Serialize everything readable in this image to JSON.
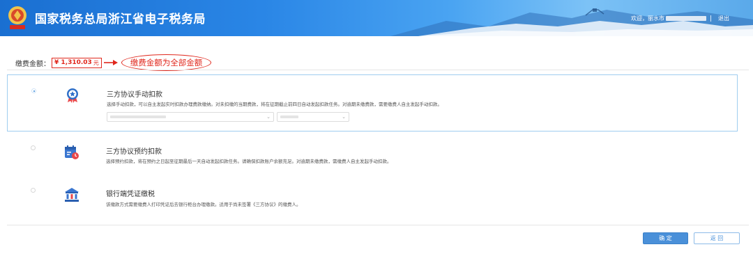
{
  "header": {
    "title": "国家税务总局浙江省电子税务局",
    "welcome": "欢迎，丽水市",
    "logout": "退出"
  },
  "payment": {
    "label": "缴费金额：",
    "amount": "¥ 1,310.03",
    "unit": "元",
    "annotation": "缴费金额为全部金额"
  },
  "options": [
    {
      "title": "三方协议手动扣款",
      "description": "选择手动扣款，可以自主发起实时扣款办理费款缴纳。对未扣缴的当期费款，将在征期截止前四日自动发起扣款任务。对逾期未缴费款，需要缴费人自主发起手动扣款。",
      "selected": true,
      "icon": "award-ribbon-icon"
    },
    {
      "title": "三方协议预约扣款",
      "description": "选择预约扣款，将在预约之日起至征期最后一天自动发起扣款任务。请确保扣款账户余额充足。对逾期未缴费款，需缴费人自主发起手动扣款。",
      "selected": false,
      "icon": "calendar-clock-icon"
    },
    {
      "title": "银行端凭证缴税",
      "description": "该缴款方式需要缴费人打印凭证后去银行柜台办理缴款。适用于尚未签署《三方协议》的缴费人。",
      "selected": false,
      "icon": "bank-icon"
    }
  ],
  "buttons": {
    "confirm": "确 定",
    "back": "返 回"
  },
  "colors": {
    "accent": "#4a90d9",
    "highlight": "#e0271c",
    "selected_border": "#9fcdf0"
  }
}
